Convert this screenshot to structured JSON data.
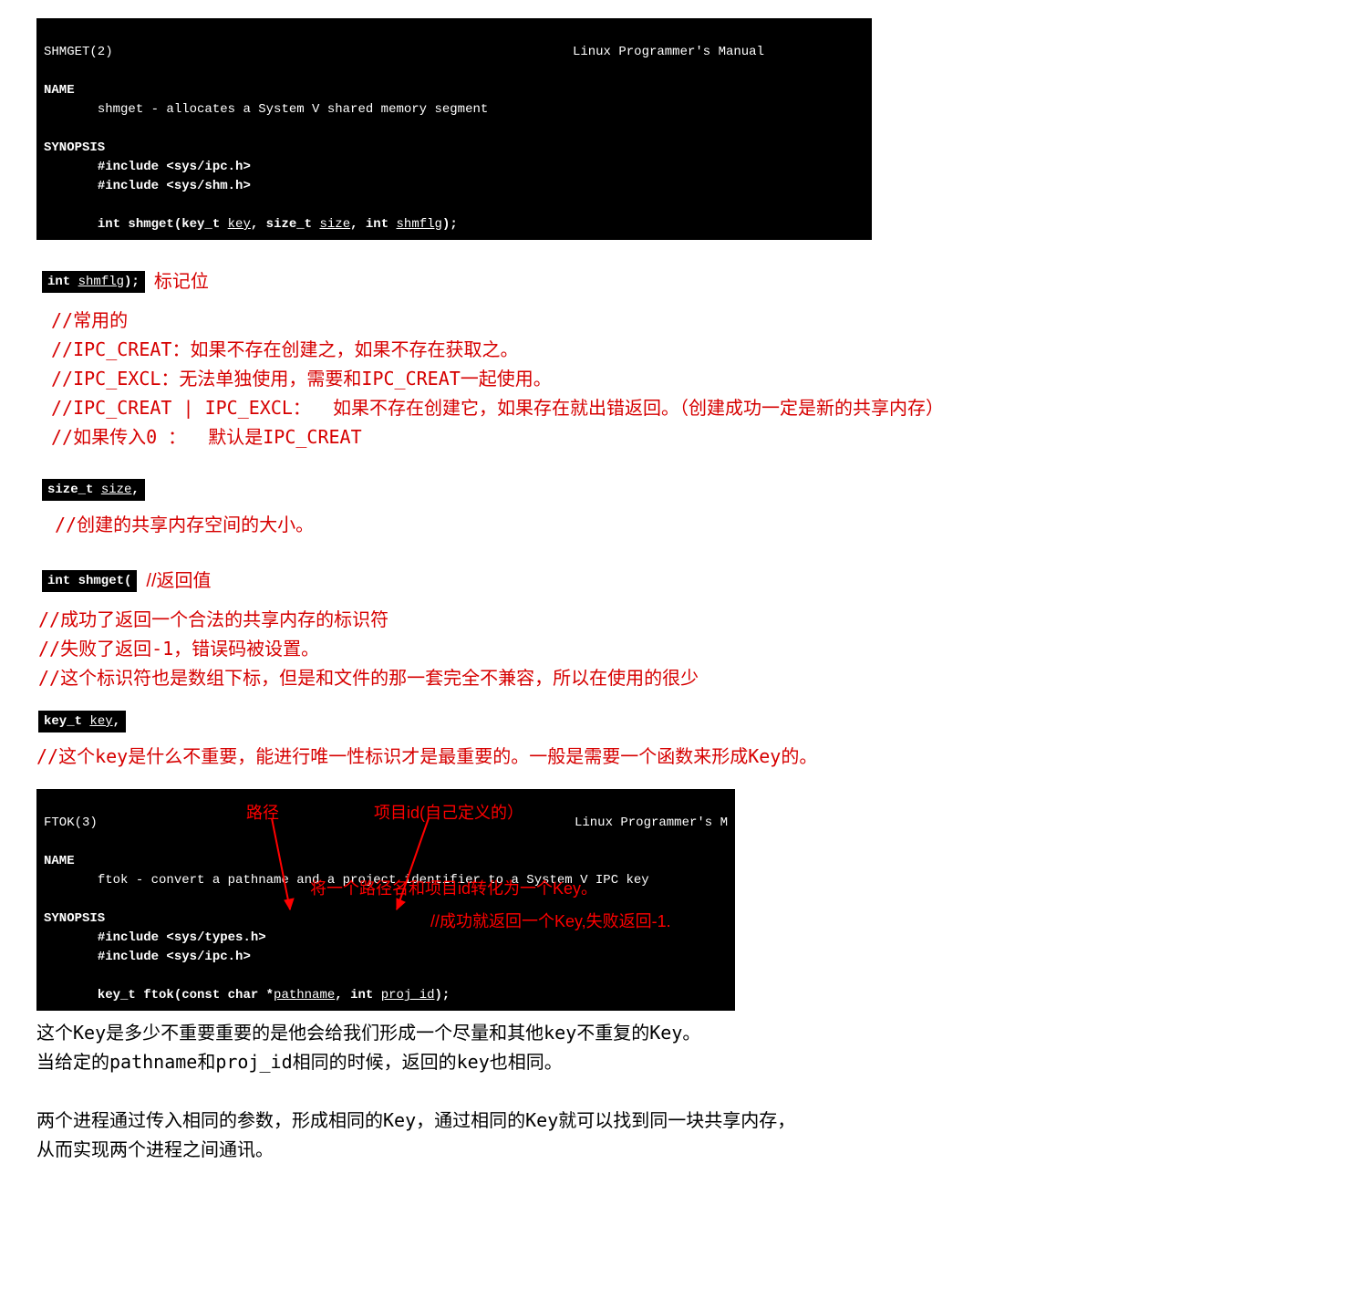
{
  "man1": {
    "left": "SHMGET(2)",
    "right": "Linux Programmer's Manual",
    "name_hdr": "NAME",
    "name_line": "shmget - allocates a System V shared memory segment",
    "syn_hdr": "SYNOPSIS",
    "inc1": "#include <sys/ipc.h>",
    "inc2": "#include <sys/shm.h>",
    "sig_pre": "int shmget(key_t ",
    "sig_key": "key",
    "sig_mid1": ", size_t ",
    "sig_size": "size",
    "sig_mid2": ", int ",
    "sig_flg": "shmflg",
    "sig_end": ");"
  },
  "snip1_pre": "int ",
  "snip1_u": "shmflg",
  "snip1_end": ");",
  "label1": "标记位",
  "block1": "//常用的\n//IPC_CREAT：如果不存在创建之，如果不存在获取之。\n//IPC_EXCL：无法单独使用，需要和IPC_CREAT一起使用。\n//IPC_CREAT | IPC_EXCL：  如果不存在创建它，如果存在就出错返回。（创建成功一定是新的共享内存）\n//如果传入0 ：  默认是IPC_CREAT",
  "snip2_pre": "size_t ",
  "snip2_u": "size",
  "snip2_end": ",",
  "block2": "//创建的共享内存空间的大小。",
  "snip3": " int shmget(",
  "label3": "//返回值",
  "block3": "//成功了返回一个合法的共享内存的标识符\n//失败了返回-1，错误码被设置。\n//这个标识符也是数组下标，但是和文件的那一套完全不兼容，所以在使用的很少",
  "snip4_pre": "key_t ",
  "snip4_u": "key",
  "snip4_end": ",",
  "block4": "//这个key是什么不重要，能进行唯一性标识才是最重要的。一般是需要一个函数来形成Key的。",
  "man2": {
    "left": "FTOK(3)",
    "right": "Linux Programmer's M",
    "name_hdr": "NAME",
    "name_line": "ftok - convert a pathname and a project identifier to a System V IPC key",
    "syn_hdr": "SYNOPSIS",
    "inc1": "#include <sys/types.h>",
    "inc2": "#include <sys/ipc.h>",
    "sig_pre": "key_t ftok(const char *",
    "sig_path": "pathname",
    "sig_mid": ", int ",
    "sig_proj": "proj_id",
    "sig_end": ");"
  },
  "ov_path": "路径",
  "ov_proj": "项目id(自己定义的）",
  "ov_mid": "将一个路径名和项目id转化为一个Key。",
  "ov_ret": "//成功就返回一个Key,失败返回-1.",
  "black_final": "这个Key是多少不重要重要的是他会给我们形成一个尽量和其他key不重复的Key。\n当给定的pathname和proj_id相同的时候，返回的key也相同。\n\n两个进程通过传入相同的参数，形成相同的Key，通过相同的Key就可以找到同一块共享内存，\n从而实现两个进程之间通讯。"
}
